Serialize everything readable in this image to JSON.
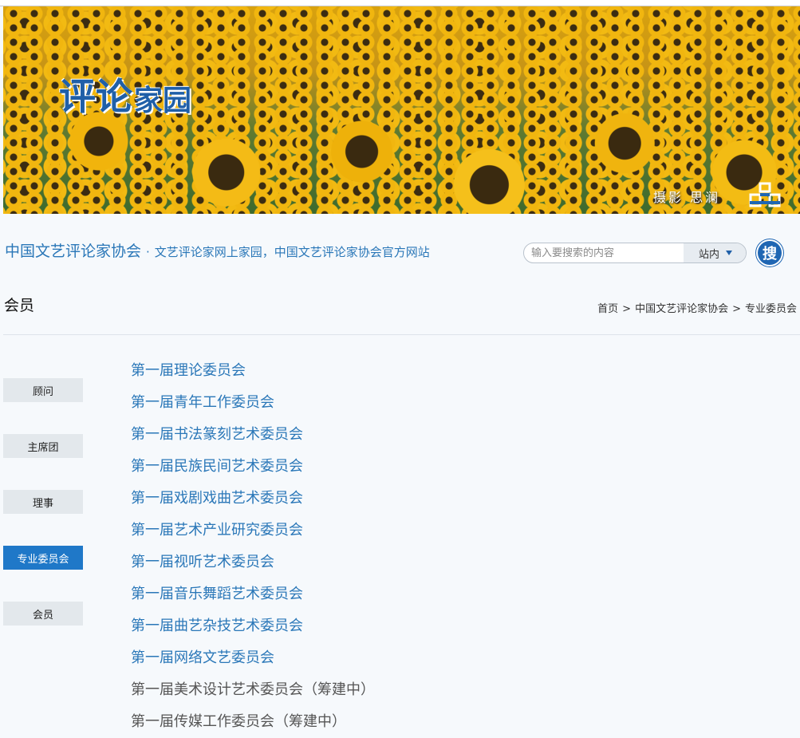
{
  "banner": {
    "title_big": "评论",
    "title_small": "家园",
    "credit": "摄影 思澜"
  },
  "header": {
    "site_name": "中国文艺评论家协会",
    "separator": "·",
    "site_desc": "文艺评论家网上家园，中国文艺评论家协会官方网站"
  },
  "search": {
    "placeholder": "输入要搜索的内容",
    "scope": "站内",
    "button_label": "搜"
  },
  "page": {
    "title": "会员"
  },
  "breadcrumb": {
    "items": [
      "首页",
      "中国文艺评论家协会",
      "专业委员会"
    ],
    "separator": ">"
  },
  "sidebar": {
    "items": [
      {
        "label": "顾问",
        "active": false
      },
      {
        "label": "主席团",
        "active": false
      },
      {
        "label": "理事",
        "active": false
      },
      {
        "label": "专业委员会",
        "active": true
      },
      {
        "label": "会员",
        "active": false
      }
    ]
  },
  "committees": [
    {
      "label": "第一届理论委员会",
      "pending": false
    },
    {
      "label": "第一届青年工作委员会",
      "pending": false
    },
    {
      "label": "第一届书法篆刻艺术委员会",
      "pending": false
    },
    {
      "label": "第一届民族民间艺术委员会",
      "pending": false
    },
    {
      "label": "第一届戏剧戏曲艺术委员会",
      "pending": false
    },
    {
      "label": "第一届艺术产业研究委员会",
      "pending": false
    },
    {
      "label": "第一届视听艺术委员会",
      "pending": false
    },
    {
      "label": "第一届音乐舞蹈艺术委员会",
      "pending": false
    },
    {
      "label": "第一届曲艺杂技艺术委员会",
      "pending": false
    },
    {
      "label": "第一届网络文艺委员会",
      "pending": false
    },
    {
      "label": "第一届美术设计艺术委员会（筹建中）",
      "pending": true
    },
    {
      "label": "第一届传媒工作委员会（筹建中）",
      "pending": true
    }
  ],
  "colors": {
    "accent": "#1f78c8",
    "link": "#2a77b8",
    "background": "#f6f9fc"
  }
}
